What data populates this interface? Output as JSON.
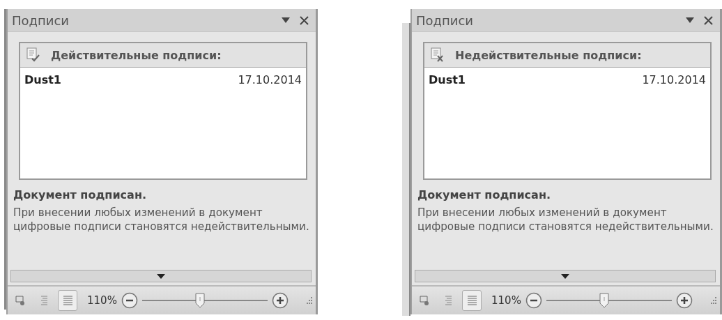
{
  "panels": [
    {
      "title": "Подписи",
      "group": {
        "kind": "valid",
        "heading": "Действительные подписи:",
        "signatures": [
          {
            "signer": "Dust1",
            "date": "17.10.2014"
          }
        ]
      },
      "status_title": "Документ подписан.",
      "status_text": "При внесении любых изменений в документ цифровые подписи становятся недействительными.",
      "views": [
        {
          "selected": false
        },
        {
          "selected": false
        },
        {
          "selected": true
        }
      ],
      "zoom": {
        "reading": "110%",
        "level": 0.46
      }
    },
    {
      "title": "Подписи",
      "group": {
        "kind": "invalid",
        "heading": "Недействительные подписи:",
        "signatures": [
          {
            "signer": "Dust1",
            "date": "17.10.2014"
          }
        ]
      },
      "status_title": "Документ подписан.",
      "status_text": "При внесении любых изменений в документ цифровые подписи становятся недействительными.",
      "views": [
        {
          "selected": false
        },
        {
          "selected": false
        },
        {
          "selected": true
        }
      ],
      "zoom": {
        "reading": "110%",
        "level": 0.46
      }
    }
  ]
}
